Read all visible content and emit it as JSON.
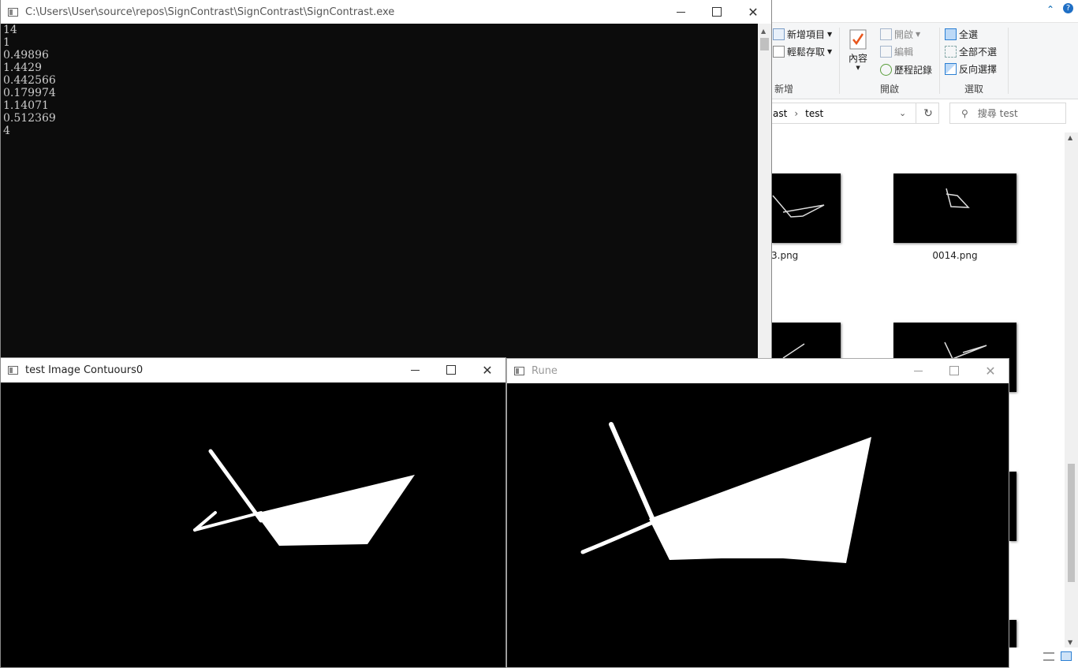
{
  "console": {
    "title": "C:\\Users\\User\\source\\repos\\SignContrast\\SignContrast\\SignContrast.exe",
    "output": [
      "14",
      "1",
      "0.49896",
      "1.4429",
      "0.442566",
      "0.179974",
      "1.14071",
      "0.512369",
      "4"
    ]
  },
  "contours_window": {
    "title": "test Image Contuours0"
  },
  "rune_window": {
    "title": "Rune"
  },
  "explorer": {
    "ribbon": {
      "new_group": {
        "label": "新增",
        "new_item": "新增項目",
        "easy_access": "輕鬆存取"
      },
      "open_group": {
        "label": "開啟",
        "properties": "內容",
        "open": "開啟",
        "edit": "編輯",
        "history": "歷程記錄"
      },
      "select_group": {
        "label": "選取",
        "select_all": "全選",
        "select_none": "全部不選",
        "invert": "反向選擇"
      }
    },
    "address": {
      "path_tail": "ast",
      "separator": "›",
      "current": "test"
    },
    "search_placeholder": "搜尋 test",
    "files": [
      {
        "name": "3.png"
      },
      {
        "name": "0014.png"
      }
    ]
  }
}
